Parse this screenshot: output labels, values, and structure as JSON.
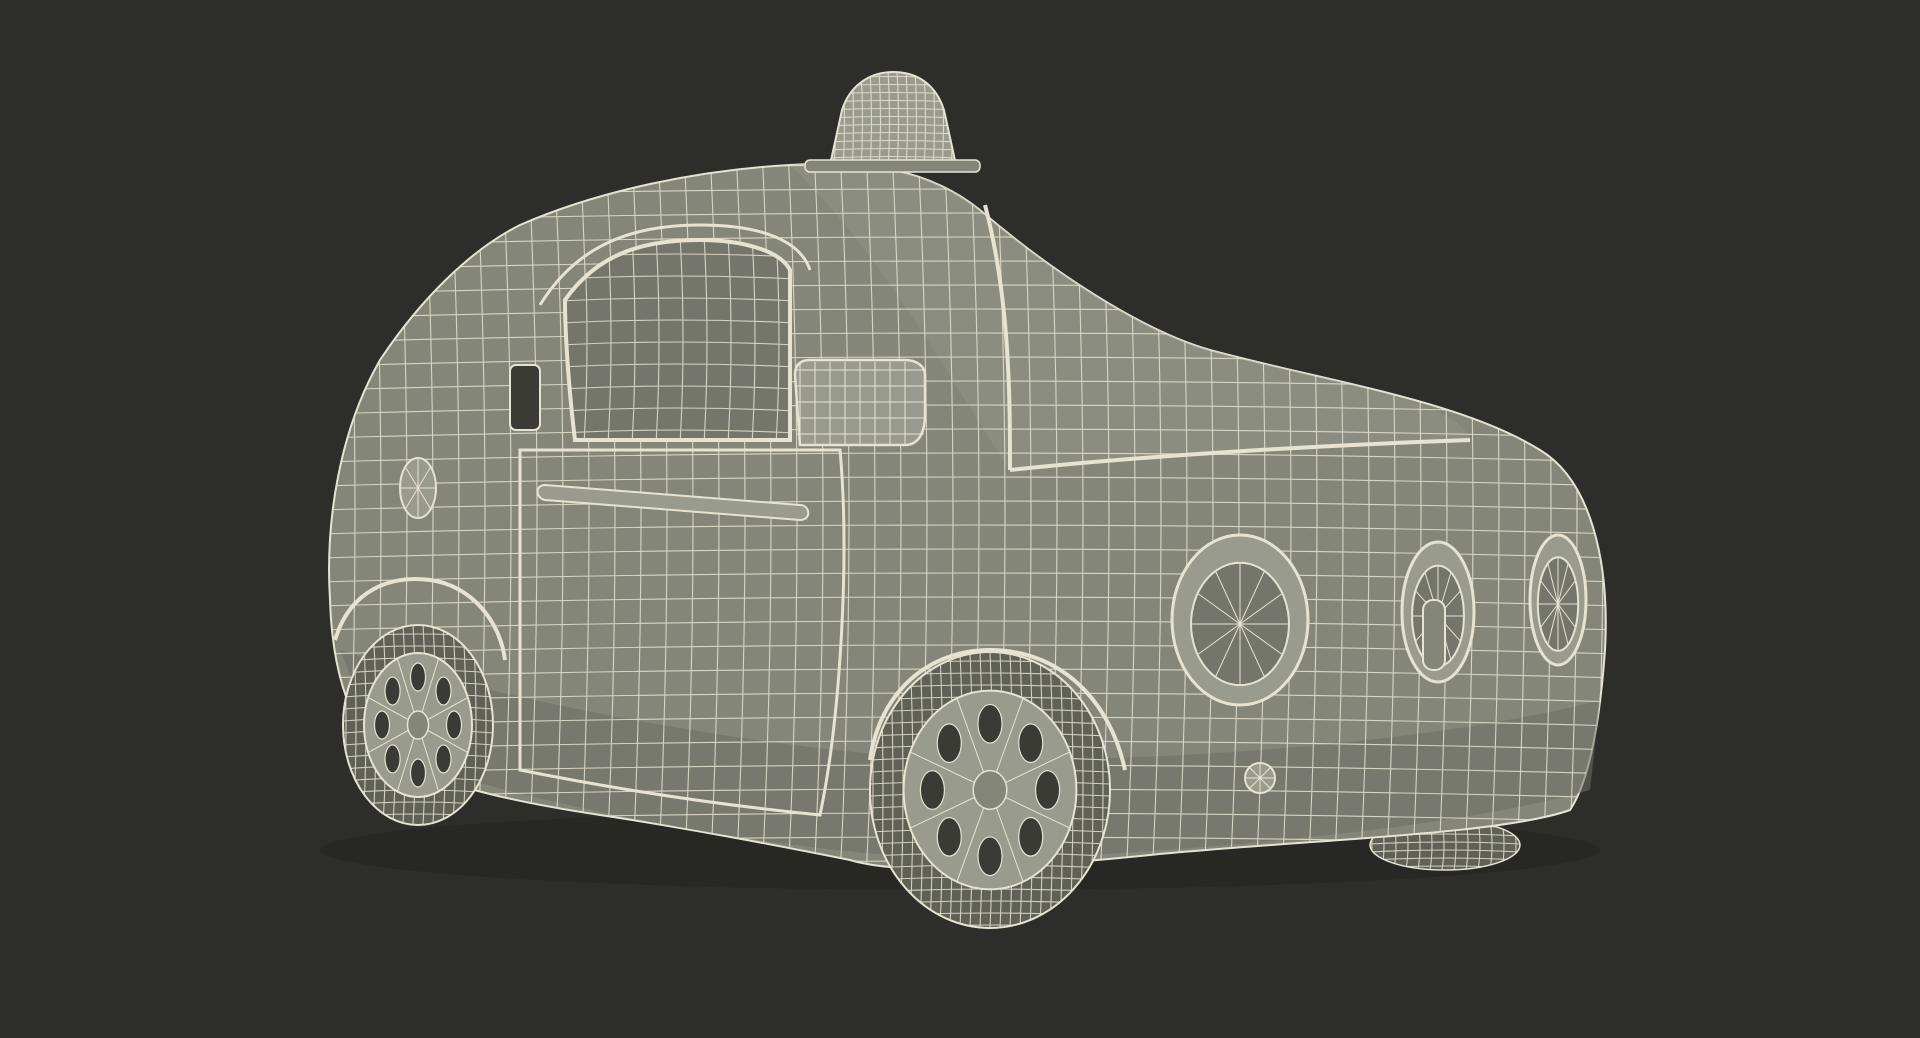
{
  "scene": {
    "subject": "wireframe-self-driving-car-model",
    "colors": {
      "background": "#2d2d2a",
      "body_fill": "#85867a",
      "body_shadow": "#6e6f64",
      "body_light": "#9a9b8f",
      "wire": "#e6e3d2",
      "tire": "#5f6056",
      "glass": "#75766b",
      "dark": "#3a3b35"
    }
  }
}
